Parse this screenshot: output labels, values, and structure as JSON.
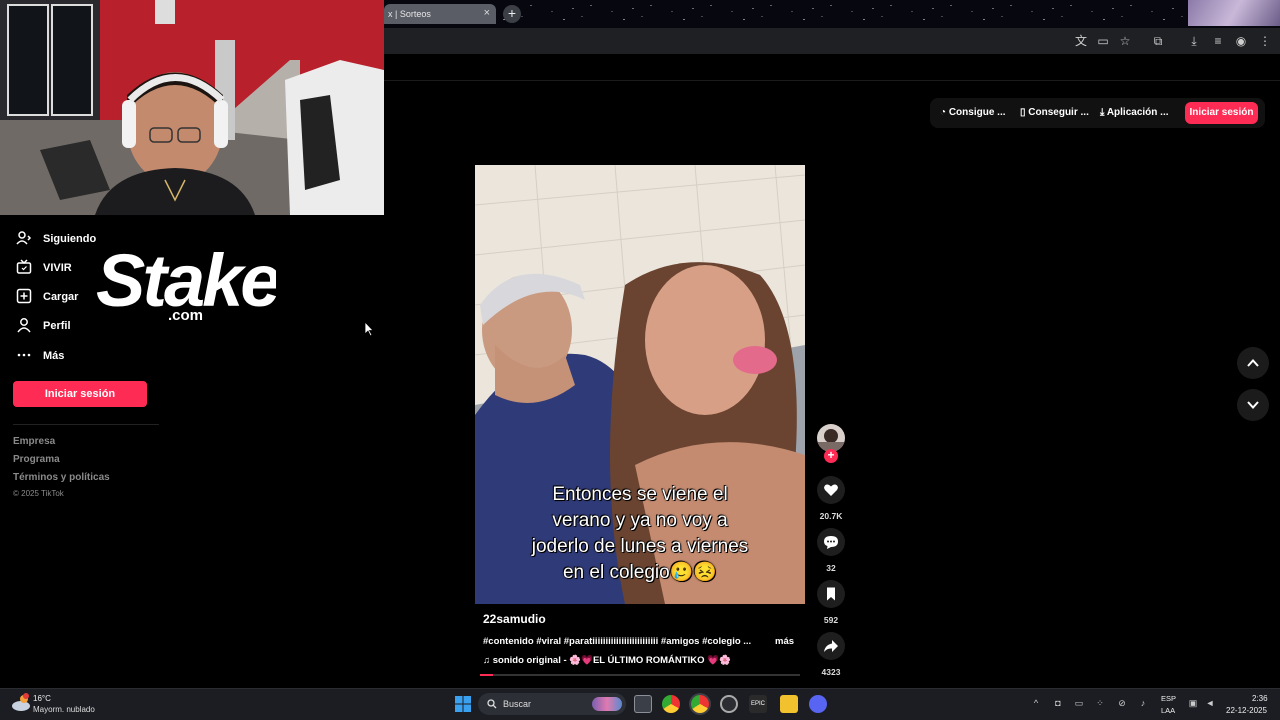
{
  "browser": {
    "tab_title": "x | Sorteos",
    "tab_close": "×",
    "new_tab": "+"
  },
  "header": {
    "buttons": [
      "Consigue ...",
      "Conseguir ...",
      "Aplicación ..."
    ],
    "signin_label": "Iniciar sesión"
  },
  "sidebar": {
    "items": [
      {
        "label": "Siguiendo",
        "icon": "following-icon"
      },
      {
        "label": "VIVIR",
        "icon": "live-icon"
      },
      {
        "label": "Cargar",
        "icon": "upload-icon"
      },
      {
        "label": "Perfil",
        "icon": "profile-icon"
      },
      {
        "label": "Más",
        "icon": "more-dots-icon"
      }
    ],
    "signin_label": "Iniciar sesión",
    "footer_links": [
      "Empresa",
      "Programa",
      "Términos y políticas"
    ],
    "copyright": "© 2025 TikTok"
  },
  "overlay": {
    "logo_word": "Stake",
    "logo_suffix": ".com"
  },
  "video": {
    "caption_lines": [
      "Entonces se viene el",
      "verano y ya no voy a",
      "joderlo de lunes a viernes",
      "en el colegio🥲😣"
    ],
    "username": "22samudio",
    "description": "#contenido #viral #paratiiiiiiiiiiiiiiiiiiiiiiiii #amigos #colegio ...",
    "more_label": "más",
    "sound": "♫  sonido original - 🌸💗EL ÚLTIMO ROMÁNTIKO 💗🌸",
    "progress": 0.04,
    "likes": "20.7K",
    "comments": "32",
    "saves": "592",
    "shares": "4323"
  },
  "taskbar": {
    "temperature": "16°C",
    "weather": "Mayorm. nublado",
    "search_label": "Buscar",
    "lang_line1": "ESP",
    "lang_line2": "LAA",
    "time": "2:36",
    "date": "22-12-2025"
  },
  "colors": {
    "accent": "#fe2c55",
    "background": "#000000",
    "taskbar": "#1b1d22"
  }
}
